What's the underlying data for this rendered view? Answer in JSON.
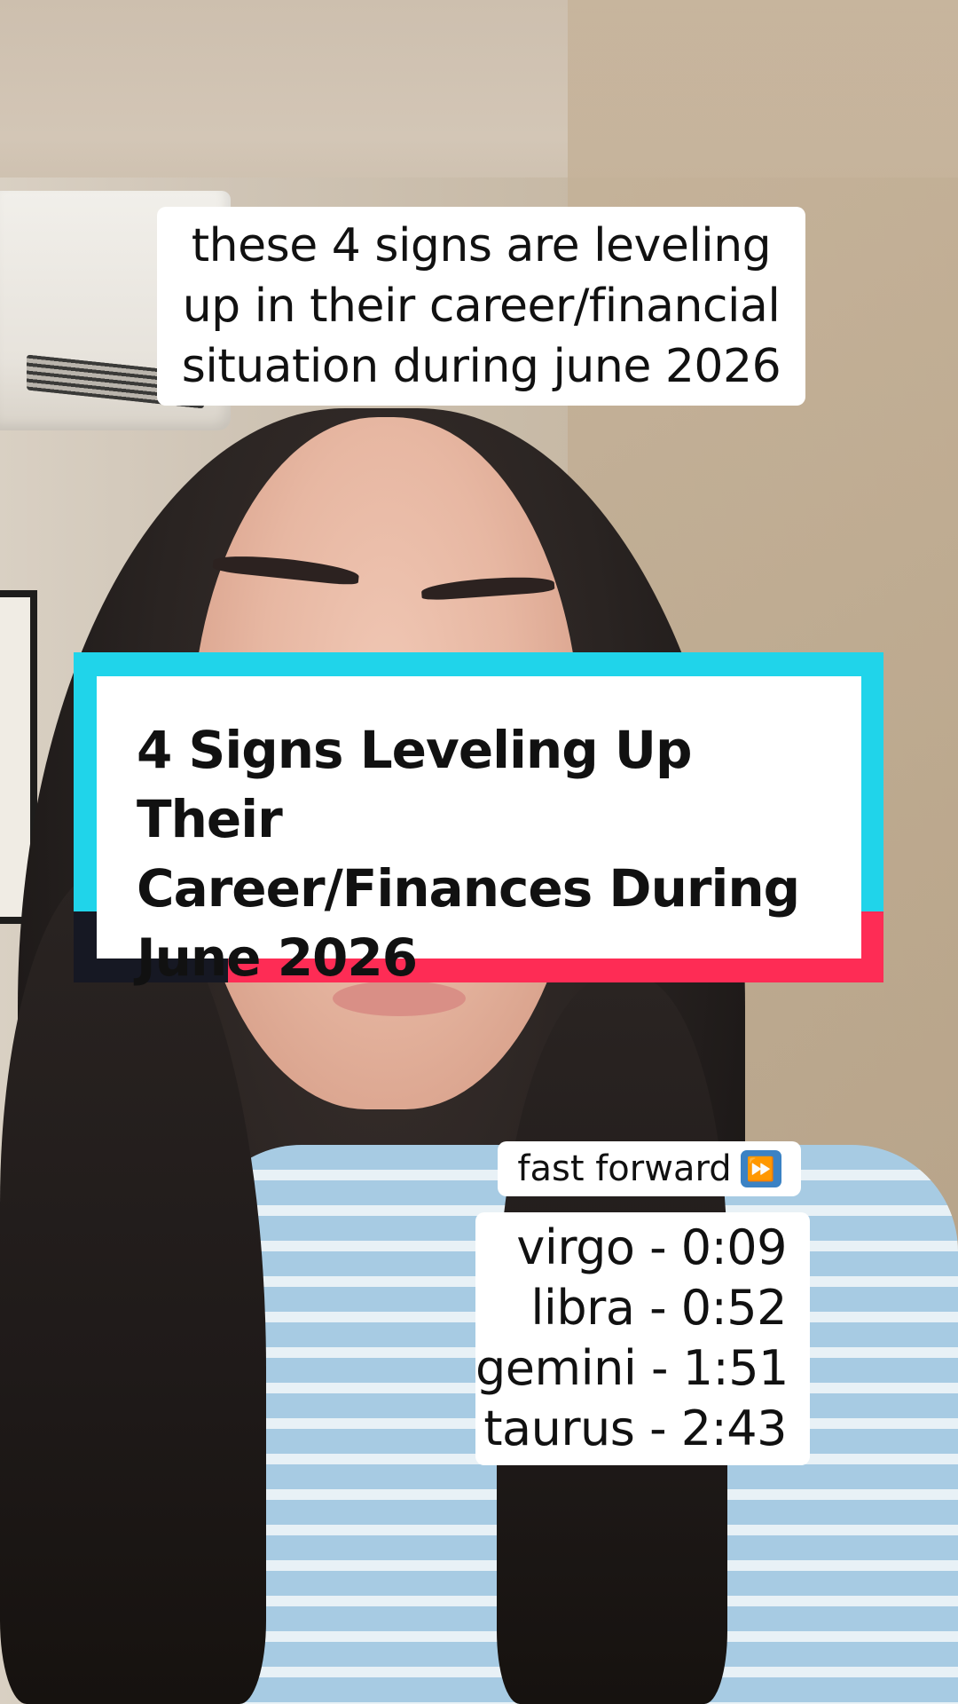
{
  "caption": {
    "lines": [
      "these 4 signs are leveling",
      "up in their career/financial",
      "situation during june 2026"
    ]
  },
  "title_card": {
    "lines": [
      "4 Signs Leveling Up Their",
      "Career/Finances During",
      "June 2026"
    ],
    "colors": {
      "cyan": "#20d4ea",
      "red": "#fe2c55",
      "dark": "#161823"
    }
  },
  "fast_forward": {
    "label": "fast forward",
    "icon": "fast-forward-icon",
    "icon_glyph": "⏩"
  },
  "timestamps": [
    {
      "text": "virgo - 0:09"
    },
    {
      "text": "libra - 0:52"
    },
    {
      "text": "gemini - 1:51"
    },
    {
      "text": "taurus - 2:43"
    }
  ]
}
